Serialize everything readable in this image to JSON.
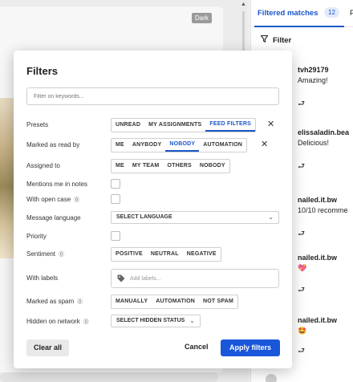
{
  "background": {
    "dark_badge": "Dark"
  },
  "right_panel": {
    "tab_active": "Filtered matches",
    "tab_badge": "12",
    "tab_next": "P",
    "filter_label": "Filter",
    "items": [
      {
        "user": "tvh29179",
        "message": "Amazing!"
      },
      {
        "user": "elissaladin.bea",
        "message": "Delicious!"
      },
      {
        "user": "nailed.it.bw",
        "message": "10/10 recomme"
      },
      {
        "user": "nailed.it.bw",
        "message": "💖"
      },
      {
        "user": "nailed.it.bw",
        "message": "🤩"
      }
    ]
  },
  "dialog": {
    "title": "Filters",
    "keyword_placeholder": "Filter on keywords...",
    "presets": {
      "label": "Presets",
      "options": [
        "UNREAD",
        "MY ASSIGNMENTS",
        "FEED FILTERS"
      ],
      "active": "FEED FILTERS"
    },
    "marked_read": {
      "label": "Marked as read by",
      "options": [
        "ME",
        "ANYBODY",
        "NOBODY",
        "AUTOMATION"
      ],
      "active": "NOBODY"
    },
    "assigned": {
      "label": "Assigned to",
      "options": [
        "ME",
        "MY TEAM",
        "OTHERS",
        "NOBODY"
      ]
    },
    "mentions": {
      "label": "Mentions me in notes"
    },
    "open_case": {
      "label": "With open case"
    },
    "language": {
      "label": "Message language",
      "value": "SELECT LANGUAGE"
    },
    "priority": {
      "label": "Priority"
    },
    "sentiment": {
      "label": "Sentiment",
      "options": [
        "POSITIVE",
        "NEUTRAL",
        "NEGATIVE"
      ]
    },
    "labels": {
      "label": "With labels",
      "placeholder": "Add labels..."
    },
    "spam": {
      "label": "Marked as spam",
      "options": [
        "MANUALLY",
        "AUTOMATION",
        "NOT SPAM"
      ]
    },
    "hidden": {
      "label": "Hidden on network",
      "value": "SELECT HIDDEN STATUS"
    },
    "clear_all": "Clear all",
    "cancel": "Cancel",
    "apply": "Apply filters"
  }
}
